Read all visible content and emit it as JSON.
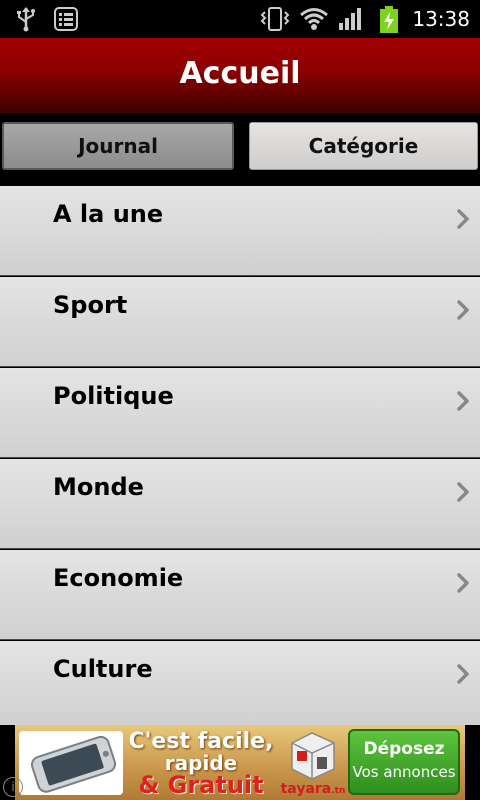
{
  "status_bar": {
    "time": "13:38",
    "icons": [
      "usb-icon",
      "notification-list-icon",
      "vibrate-icon",
      "wifi-icon",
      "signal-icon",
      "battery-charging-icon"
    ],
    "battery_color": "#7ed321"
  },
  "header": {
    "title": "Accueil",
    "colors": {
      "top": "#a30000",
      "bottom": "#3a0000"
    }
  },
  "tabs": [
    {
      "label": "Journal",
      "selected": true
    },
    {
      "label": "Catégorie",
      "selected": false
    }
  ],
  "list": {
    "items": [
      {
        "label": "A la une"
      },
      {
        "label": "Sport"
      },
      {
        "label": "Politique"
      },
      {
        "label": "Monde"
      },
      {
        "label": "Economie"
      },
      {
        "label": "Culture"
      }
    ],
    "chevron_icon": "chevron-right-icon"
  },
  "ad": {
    "line1": "C'est facile,",
    "line2": "rapide",
    "line3": "& Gratuit",
    "logo_text": "tayara",
    "logo_suffix": ".tn",
    "button_line1": "Déposez",
    "button_line2": "Vos annonces",
    "info_icon": "info-icon"
  }
}
